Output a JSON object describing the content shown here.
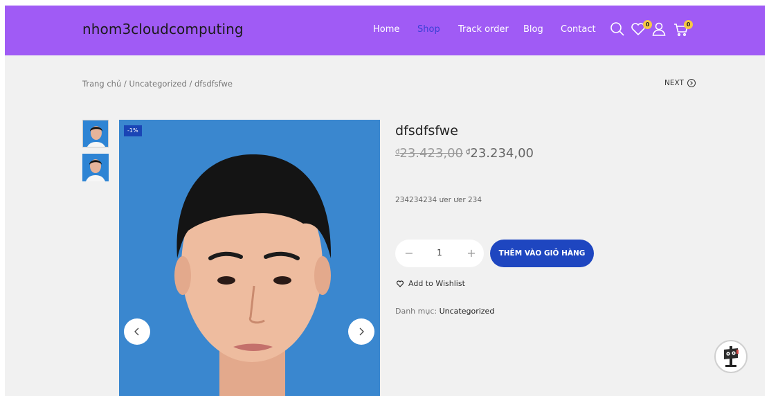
{
  "header": {
    "logo": "nhom3cloudcomputing",
    "nav": [
      "Home",
      "Shop",
      "Track order",
      "Blog",
      "Contact"
    ],
    "active_nav": "Shop",
    "wishlist_count": "0",
    "cart_count": "0",
    "icons": [
      "search-icon",
      "heart-icon",
      "user-icon",
      "cart-icon"
    ],
    "bg_color": "#a05bf5"
  },
  "breadcrumb": {
    "items": [
      "Trang chủ",
      "Uncategorized",
      "dfsdfsfwe"
    ],
    "separator": "/"
  },
  "next_label": "NEXT",
  "gallery": {
    "sale_badge": "-1%"
  },
  "product": {
    "title": "dfsdfsfwe",
    "old_price_symbol": "₫",
    "old_price": "23.423,00",
    "new_price_symbol": "₫",
    "new_price": "23.234,00",
    "description": "234234234 ưer ưer 234",
    "quantity": "1",
    "add_to_cart": "THÊM VÀO GIỎ HÀNG",
    "wishlist_label": "Add to Wishlist",
    "category_label": "Danh mục:",
    "category_value": "Uncategorized"
  },
  "colors": {
    "accent": "#1e46c0",
    "sale_badge": "#1a45b5"
  }
}
